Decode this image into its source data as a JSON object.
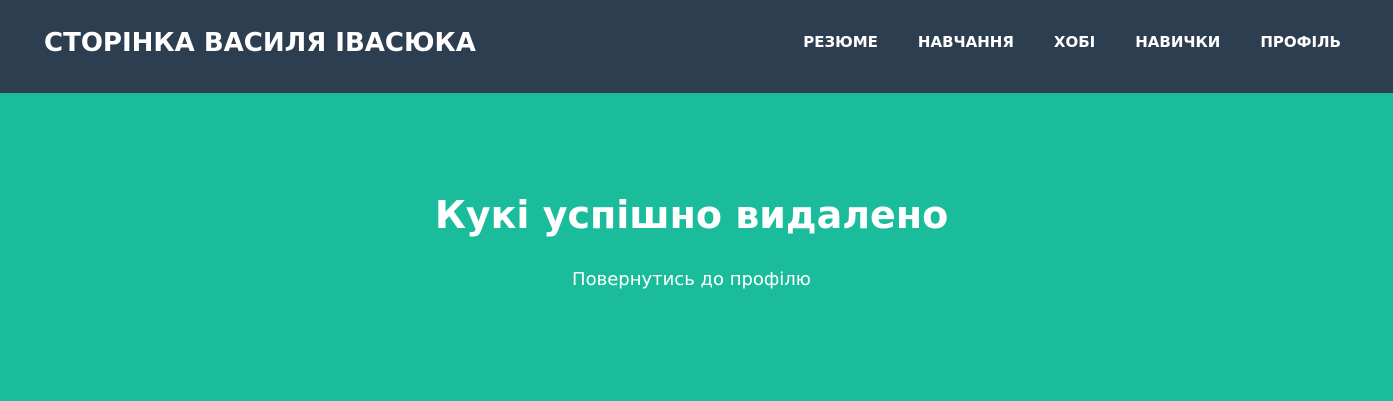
{
  "header": {
    "brand": "СТОРІНКА ВАСИЛЯ ІВАСЮКА",
    "nav": [
      {
        "label": "РЕЗЮМЕ"
      },
      {
        "label": "НАВЧАННЯ"
      },
      {
        "label": "ХОБІ"
      },
      {
        "label": "НАВИЧКИ"
      },
      {
        "label": "ПРОФІЛЬ"
      }
    ]
  },
  "main": {
    "title": "Кукі успішно видалено",
    "back_link": "Повернутись до профілю"
  },
  "colors": {
    "navbar": "#2e3e51",
    "hero": "#1bbc9b",
    "text": "#ffffff"
  }
}
